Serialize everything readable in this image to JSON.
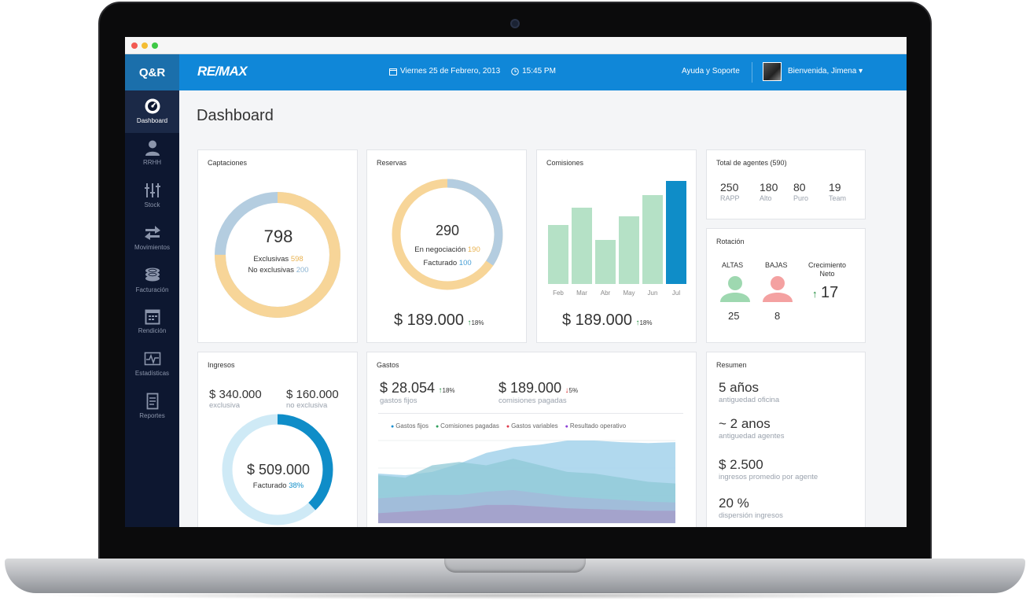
{
  "app": {
    "short_brand": "Q&R",
    "brand": "RE/MAX",
    "date": "Viernes 25 de Febrero, 2013",
    "time": "15:45 PM",
    "help": "Ayuda y Soporte",
    "user_greeting": "Bienvenida, Jimena"
  },
  "sidebar": {
    "items": [
      {
        "label": "Dashboard",
        "icon": "dashboard-gauge-icon"
      },
      {
        "label": "RRHH",
        "icon": "person-icon"
      },
      {
        "label": "Stock",
        "icon": "sliders-icon"
      },
      {
        "label": "Movimientos",
        "icon": "transfer-arrows-icon"
      },
      {
        "label": "Facturación",
        "icon": "coins-icon"
      },
      {
        "label": "Rendición",
        "icon": "calendar-icon"
      },
      {
        "label": "Estadísticas",
        "icon": "pulse-chart-icon"
      },
      {
        "label": "Reportes",
        "icon": "document-icon"
      }
    ]
  },
  "page": {
    "title": "Dashboard"
  },
  "captaciones": {
    "title": "Captaciones",
    "total": "798",
    "exclusivas_label": "Exclusivas",
    "exclusivas_value": "598",
    "no_exclusivas_label": "No exclusivas",
    "no_exclusivas_value": "200",
    "exclusivas_fraction": 0.75,
    "colors": {
      "exclusivas": "#f7d598",
      "no_exclusivas": "#b4cde0"
    }
  },
  "reservas": {
    "title": "Reservas",
    "total": "290",
    "negociacion_label": "En negociación",
    "negociacion_value": "190",
    "facturado_label": "Facturado",
    "facturado_value": "100",
    "facturado_fraction": 0.345,
    "amount": "$ 189.000",
    "change": "18%"
  },
  "comisiones": {
    "title": "Comisiones",
    "amount": "$ 189.000",
    "change": "18%"
  },
  "chart_data": [
    {
      "type": "bar",
      "categories": [
        "Feb",
        "Mar",
        "Abr",
        "May",
        "Jun",
        "Jul"
      ],
      "values": [
        57,
        74,
        43,
        66,
        86,
        100
      ],
      "colors": [
        "#b5e1c6",
        "#b5e1c6",
        "#b5e1c6",
        "#b5e1c6",
        "#b5e1c6",
        "#0f8dc8"
      ]
    },
    {
      "type": "area",
      "legend": [
        "Gastos fijos",
        "Comisiones pagadas",
        "Gastos variables",
        "Resultado operativo"
      ],
      "legend_colors": [
        "#1a8fd1",
        "#2e9e5b",
        "#e0394a",
        "#8b3fd6"
      ],
      "x": [
        1,
        2,
        3,
        4,
        5,
        6,
        7,
        8,
        9,
        10,
        11,
        12
      ],
      "series": [
        {
          "name": "Gastos fijos",
          "values": [
            60,
            58,
            62,
            72,
            85,
            92,
            95,
            100,
            100,
            98,
            97,
            98
          ]
        },
        {
          "name": "Comisiones pagadas",
          "values": [
            58,
            55,
            70,
            74,
            70,
            78,
            70,
            62,
            60,
            55,
            50,
            48
          ]
        },
        {
          "name": "Gastos variables",
          "values": [
            30,
            32,
            34,
            34,
            38,
            40,
            36,
            32,
            30,
            28,
            26,
            25
          ]
        },
        {
          "name": "Resultado operativo",
          "values": [
            12,
            14,
            16,
            18,
            22,
            22,
            20,
            18,
            17,
            16,
            15,
            15
          ]
        }
      ]
    }
  ],
  "agentes": {
    "title": "Total de agentes (590)",
    "stats": [
      {
        "value": "250",
        "label": "RAPP"
      },
      {
        "value": "180",
        "label": "Alto"
      },
      {
        "value": "80",
        "label": "Puro"
      },
      {
        "value": "19",
        "label": "Team"
      }
    ]
  },
  "rotacion": {
    "title": "Rotación",
    "altas_label": "ALTAS",
    "bajas_label": "BAJAS",
    "crecimiento_label": "Crecimiento Neto",
    "altas_value": "25",
    "bajas_value": "8",
    "crecimiento_value": "17"
  },
  "ingresos": {
    "title": "Ingresos",
    "exclusiva_value": "$ 340.000",
    "exclusiva_label": "exclusiva",
    "no_exclusiva_value": "$ 160.000",
    "no_exclusiva_label": "no exclusiva",
    "total": "$ 509.000",
    "facturado_label": "Facturado",
    "facturado_pct": "38%",
    "facturado_fraction": 0.38
  },
  "gastos": {
    "title": "Gastos",
    "fijos_value": "$ 28.054",
    "fijos_change": "18%",
    "fijos_label": "gastos fijos",
    "comisiones_value": "$ 189.000",
    "comisiones_change": "5%",
    "comisiones_label": "comisiones pagadas"
  },
  "resumen": {
    "title": "Resumen",
    "items": [
      {
        "value": "5 años",
        "label": "antiguedad oficina"
      },
      {
        "value": "~ 2 anos",
        "label": "antiguedad agentes"
      },
      {
        "value": "$ 2.500",
        "label": "ingresos promedio por agente"
      },
      {
        "value": "20 %",
        "label": "dispersión ingresos"
      }
    ]
  }
}
